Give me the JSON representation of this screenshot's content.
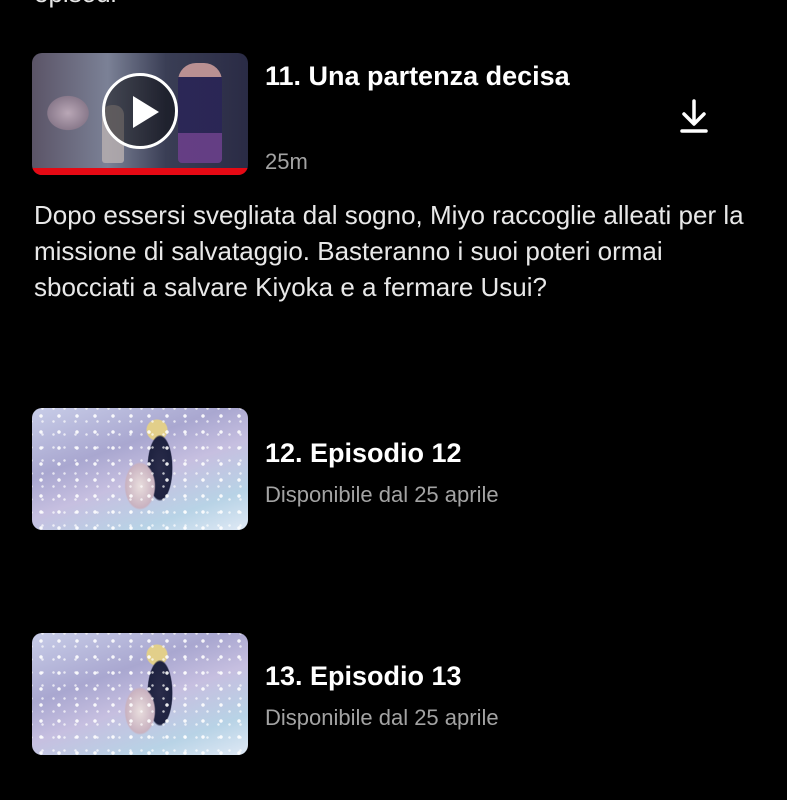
{
  "header_fragment": "episodi",
  "episodes": [
    {
      "title": "11. Una partenza decisa",
      "meta": "25m",
      "description": "Dopo essersi svegliata dal sogno, Miyo raccoglie alleati per la missione di salvataggio. Basteranno i suoi poteri ormai sbocciati a salvare Kiyoka e a fermare Usui?",
      "progress_fraction": 1.0,
      "download_icon": "download-icon"
    },
    {
      "title": "12. Episodio 12",
      "meta": "Disponibile dal 25 aprile"
    },
    {
      "title": "13. Episodio 13",
      "meta": "Disponibile dal 25 aprile"
    }
  ],
  "colors": {
    "background": "#000000",
    "progress": "#e50914",
    "meta_text": "#a3a3a3"
  }
}
